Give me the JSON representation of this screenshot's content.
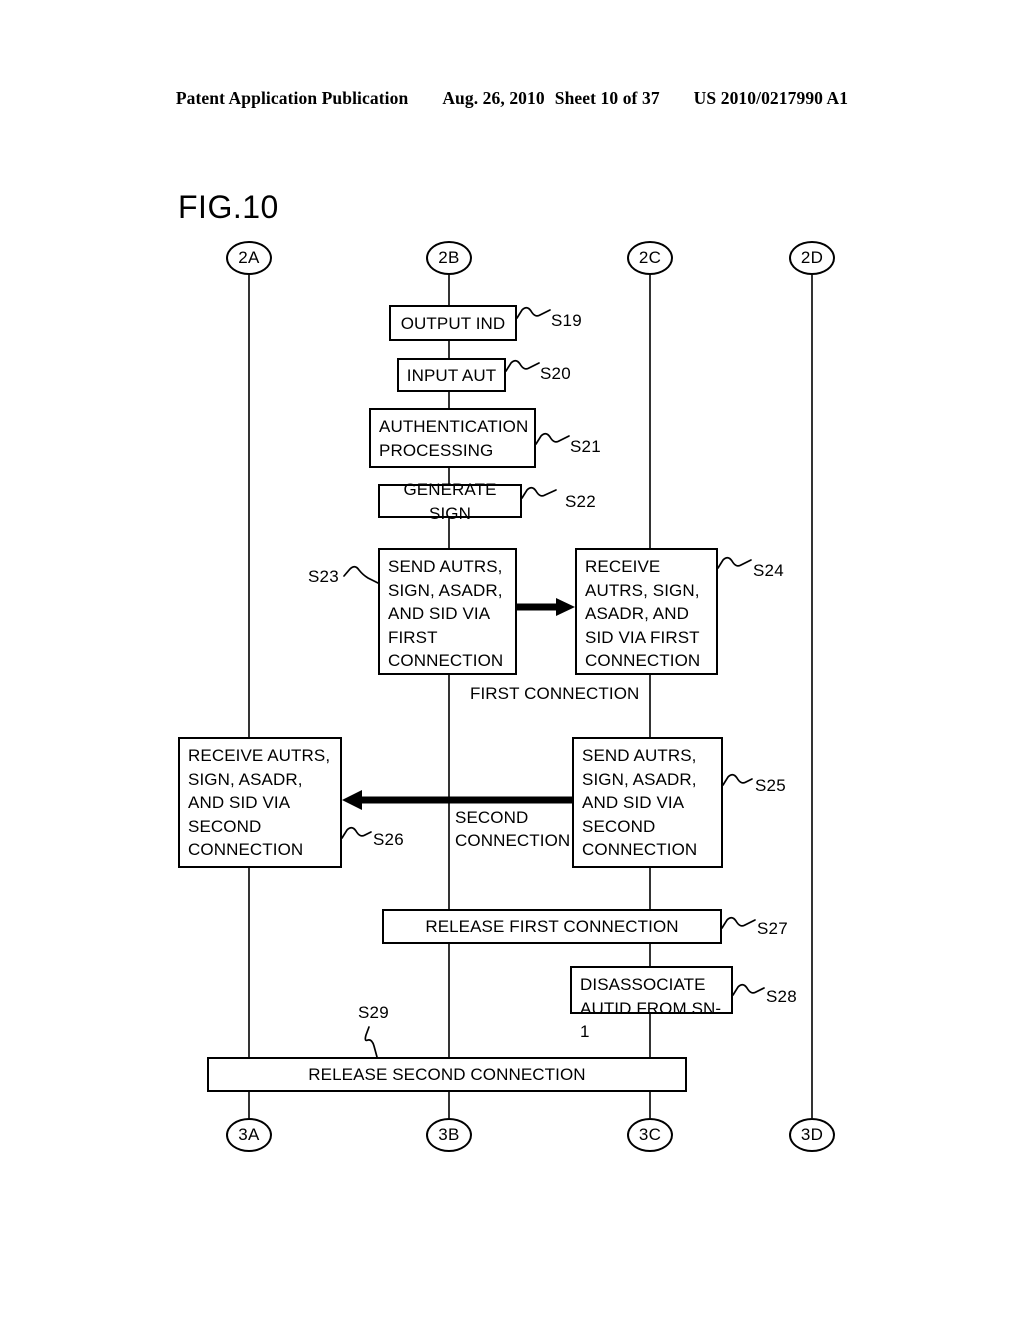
{
  "header": {
    "publication": "Patent Application Publication",
    "date": "Aug. 26, 2010",
    "sheet": "Sheet 10 of 37",
    "patent_number": "US 2010/0217990 A1"
  },
  "figure": {
    "title": "FIG.10",
    "top_nodes": [
      {
        "label": "2A"
      },
      {
        "label": "2B"
      },
      {
        "label": "2C"
      },
      {
        "label": "2D"
      }
    ],
    "bottom_nodes": [
      {
        "label": "3A"
      },
      {
        "label": "3B"
      },
      {
        "label": "3C"
      },
      {
        "label": "3D"
      }
    ],
    "steps": [
      {
        "id": "S19",
        "text": "OUTPUT IND"
      },
      {
        "id": "S20",
        "text": "INPUT AUT"
      },
      {
        "id": "S21",
        "text": "AUTHENTICATION PROCESSING"
      },
      {
        "id": "S22",
        "text": "GENERATE SIGN"
      },
      {
        "id": "S23",
        "text": "SEND AUTRS, SIGN, ASADR, AND SID VIA FIRST CONNECTION"
      },
      {
        "id": "S24",
        "text": "RECEIVE AUTRS, SIGN, ASADR, AND SID VIA FIRST CONNECTION"
      },
      {
        "id": "S25",
        "text": "SEND AUTRS, SIGN, ASADR, AND SID VIA SECOND CONNECTION"
      },
      {
        "id": "S26",
        "text": "RECEIVE AUTRS, SIGN, ASADR, AND SID VIA SECOND CONNECTION"
      },
      {
        "id": "S27",
        "text": "RELEASE FIRST CONNECTION"
      },
      {
        "id": "S28",
        "text": "DISASSOCIATE AUTID FROM SN-1"
      },
      {
        "id": "S29",
        "text": "RELEASE SECOND CONNECTION"
      }
    ],
    "captions": {
      "first_connection": "FIRST CONNECTION",
      "second_connection_line1": "SECOND",
      "second_connection_line2": "CONNECTION"
    },
    "box_lines": {
      "s21": [
        "AUTHENTICATION",
        "PROCESSING"
      ],
      "s23": [
        "SEND AUTRS,",
        "SIGN, ASADR,",
        "AND SID VIA",
        "FIRST",
        "CONNECTION"
      ],
      "s24": [
        "RECEIVE",
        "AUTRS, SIGN,",
        "ASADR, AND",
        "SID VIA FIRST",
        "CONNECTION"
      ],
      "s25": [
        "SEND AUTRS,",
        "SIGN, ASADR,",
        "AND SID VIA",
        "SECOND",
        "CONNECTION"
      ],
      "s26": [
        "RECEIVE AUTRS,",
        "SIGN, ASADR,",
        "AND SID VIA",
        "SECOND",
        "CONNECTION"
      ],
      "s28": [
        "DISASSOCIATE",
        "AUTID FROM SN-1"
      ]
    }
  },
  "colors": {
    "ink": "#000000",
    "paper": "#ffffff"
  }
}
